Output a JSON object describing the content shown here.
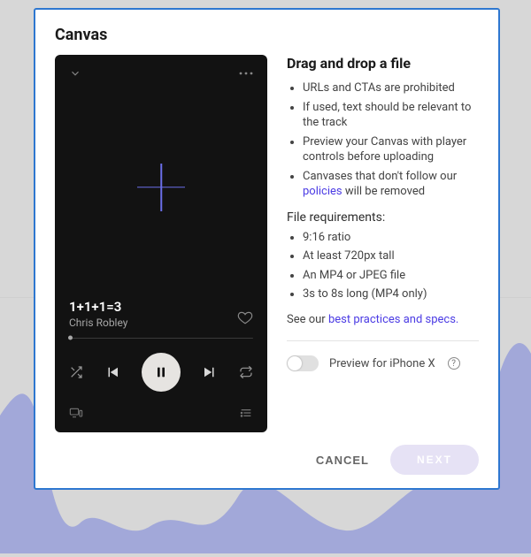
{
  "modal": {
    "title": "Canvas",
    "phone": {
      "track_title": "1+1+1=3",
      "artist": "Chris Robley"
    },
    "side": {
      "heading": "Drag and drop a file",
      "rules": [
        "URLs and CTAs are prohibited",
        "If used, text should be relevant to the track",
        "Preview your Canvas with player controls before uploading"
      ],
      "rule4_pre": "Canvases that don't follow our ",
      "policies_link": "policies",
      "rule4_post": " will be removed",
      "filereq_label": "File requirements:",
      "filereq": [
        "9:16 ratio",
        "At least 720px tall",
        "An MP4 or JPEG file",
        "3s to 8s long (MP4 only)"
      ],
      "seeour_pre": "See our ",
      "best_practices_link": "best practices and specs.",
      "toggle_label": "Preview for iPhone X"
    },
    "footer": {
      "cancel": "CANCEL",
      "next": "NEXT"
    }
  }
}
